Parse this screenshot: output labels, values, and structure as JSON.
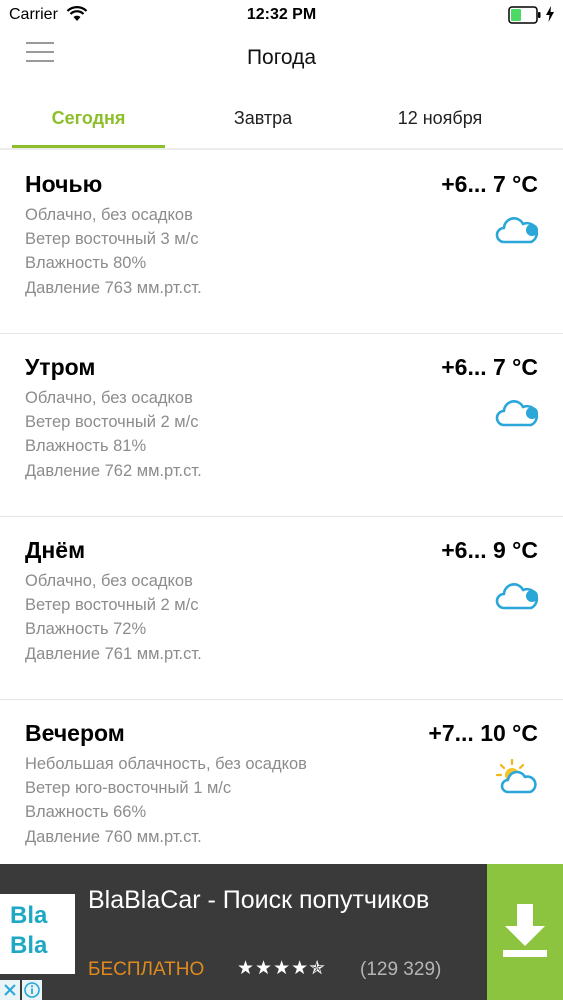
{
  "status_bar": {
    "carrier": "Carrier",
    "time": "12:32 PM",
    "battery_color": "#4cd964"
  },
  "nav": {
    "title": "Погода",
    "menu_icon": "hamburger-menu-icon"
  },
  "tabs": [
    {
      "label": "Сегодня",
      "active": true
    },
    {
      "label": "Завтра",
      "active": false
    },
    {
      "label": "12 ноября",
      "active": false
    }
  ],
  "accent_color": "#8dbf2a",
  "forecast": [
    {
      "period": "Ночью",
      "temp": "+6... 7 °C",
      "condition": "Облачно, без осадков",
      "wind": "Ветер восточный 3 м/с",
      "humidity": "Влажность 80%",
      "pressure": "Давление 763 мм.рт.ст.",
      "icon": "cloud-icon"
    },
    {
      "period": "Утром",
      "temp": "+6... 7 °C",
      "condition": "Облачно, без осадков",
      "wind": "Ветер восточный 2 м/с",
      "humidity": "Влажность 81%",
      "pressure": "Давление 762 мм.рт.ст.",
      "icon": "cloud-icon"
    },
    {
      "period": "Днём",
      "temp": "+6... 9 °C",
      "condition": "Облачно, без осадков",
      "wind": "Ветер восточный 2 м/с",
      "humidity": "Влажность 72%",
      "pressure": "Давление 761 мм.рт.ст.",
      "icon": "cloud-icon"
    },
    {
      "period": "Вечером",
      "temp": "+7... 10 °C",
      "condition": "Небольшая облачность, без осадков",
      "wind": "Ветер юго-восточный 1 м/с",
      "humidity": "Влажность 66%",
      "pressure": "Давление 760 мм.рт.ст.",
      "icon": "sun-cloud-icon"
    }
  ],
  "ad": {
    "logo_line1": "Bla",
    "logo_line2": "Bla",
    "title": "BlaBlaCar - Поиск попутчиков",
    "price": "БЕСПЛАТНО",
    "stars": "★★★★✯",
    "rating_value": 4.5,
    "reviews": "(129 329)",
    "close_glyph": "✕",
    "info_glyph": "ⓘ",
    "download_color": "#8cc43f"
  }
}
